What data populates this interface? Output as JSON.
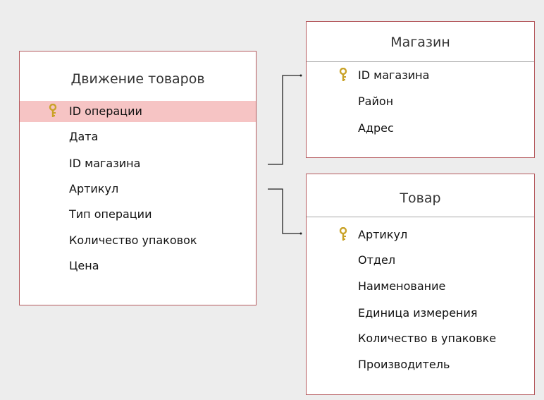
{
  "tables": {
    "movement": {
      "title": "Движение товаров",
      "fields": [
        {
          "label": "ID операции",
          "primary_key": true
        },
        {
          "label": "Дата"
        },
        {
          "label": "ID магазина"
        },
        {
          "label": "Артикул"
        },
        {
          "label": "Тип операции"
        },
        {
          "label": "Количество упаковок"
        },
        {
          "label": "Цена"
        }
      ]
    },
    "store": {
      "title": "Магазин",
      "fields": [
        {
          "label": "ID магазина",
          "primary_key": true
        },
        {
          "label": "Район"
        },
        {
          "label": "Адрес"
        }
      ]
    },
    "product": {
      "title": "Товар",
      "fields": [
        {
          "label": "Артикул",
          "primary_key": true
        },
        {
          "label": "Отдел"
        },
        {
          "label": "Наименование"
        },
        {
          "label": "Единица измерения"
        },
        {
          "label": "Количество в упаковке"
        },
        {
          "label": "Производитель"
        }
      ]
    }
  },
  "selected_field": "tables.movement.fields.0",
  "colors": {
    "background": "#ededed",
    "table_border": "#b55a5e",
    "selected_row": "#f6c4c4",
    "key_icon": "#c9a227",
    "relation_line": "#222222"
  },
  "icons": {
    "primary_key": "key-icon"
  }
}
